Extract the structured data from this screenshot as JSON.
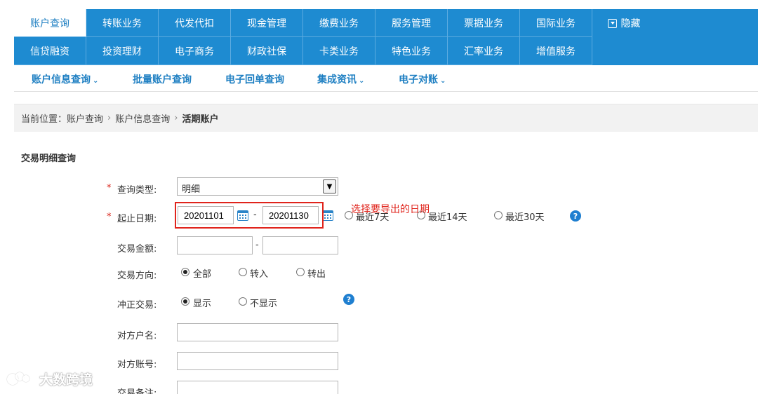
{
  "nav": {
    "row1": [
      "账户查询",
      "转账业务",
      "代发代扣",
      "现金管理",
      "缴费业务",
      "服务管理",
      "票据业务",
      "国际业务"
    ],
    "row2": [
      "信贷融资",
      "投资理财",
      "电子商务",
      "财政社保",
      "卡类业务",
      "特色业务",
      "汇率业务",
      "增值服务"
    ],
    "active": "账户查询",
    "hide_label": "隐藏"
  },
  "subnav": [
    "账户信息查询",
    "批量账户查询",
    "电子回单查询",
    "集成资讯",
    "电子对账"
  ],
  "breadcrumb": {
    "prefix": "当前位置：",
    "items": [
      "账户查询",
      "账户信息查询"
    ],
    "current": "活期账户"
  },
  "section_title": "交易明细查询",
  "form": {
    "query_type": {
      "required_mark": "*",
      "label": "查询类型:",
      "value": "明细"
    },
    "date_range": {
      "required_mark": "*",
      "label": "起止日期:",
      "start": "20201101",
      "end": "20201130",
      "separator": "-",
      "quick": [
        "最近7天",
        "最近14天",
        "最近30天"
      ]
    },
    "amount": {
      "label": "交易金额:",
      "separator": "-",
      "from": "",
      "to": ""
    },
    "direction": {
      "label": "交易方向:",
      "options": [
        "全部",
        "转入",
        "转出"
      ],
      "selected": "全部"
    },
    "reversal": {
      "label": "冲正交易:",
      "options": [
        "显示",
        "不显示"
      ],
      "selected": "显示"
    },
    "counterparty_name": {
      "label": "对方户名:",
      "value": ""
    },
    "counterparty_account": {
      "label": "对方账号:",
      "value": ""
    },
    "remark": {
      "label": "交易备注:",
      "value": ""
    }
  },
  "annotation": "选择要导出的日期",
  "watermark": "大数跨境",
  "colors": {
    "nav_blue": "#1e8bd1",
    "link_blue": "#1e7fc2",
    "annotation_red": "#e0241c"
  }
}
